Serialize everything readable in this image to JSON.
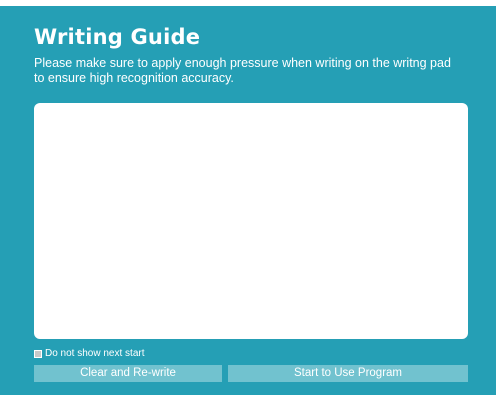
{
  "guide": {
    "title": "Writing Guide",
    "instructions": "Please make sure to apply enough pressure when writing on the writng pad to ensure high recognition accuracy."
  },
  "options": {
    "do_not_show_label": "Do not show next start",
    "do_not_show_checked": false
  },
  "actions": {
    "clear_label": "Clear and Re-write",
    "start_label": "Start to Use Program"
  },
  "colors": {
    "panel_background": "#259fb5",
    "button_background": "#71c2cf",
    "pad_background": "#ffffff"
  }
}
